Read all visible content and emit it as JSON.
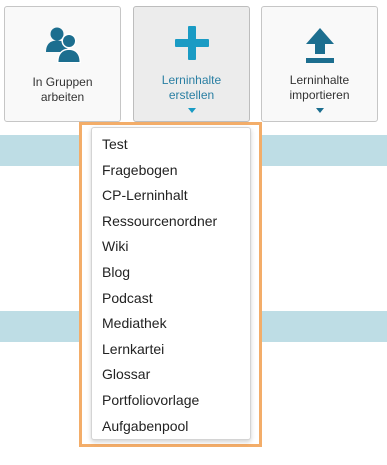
{
  "tiles": [
    {
      "label_line1": "In Gruppen",
      "label_line2": "arbeiten",
      "icon": "users-icon"
    },
    {
      "label_line1": "Lerninhalte",
      "label_line2": "erstellen",
      "icon": "plus-icon",
      "caret": "chevron-down-icon"
    },
    {
      "label_line1": "Lerninhalte",
      "label_line2": "importieren",
      "icon": "upload-icon",
      "caret": "chevron-down-icon"
    }
  ],
  "dropdown": {
    "items": [
      "Test",
      "Fragebogen",
      "CP-Lerninhalt",
      "Ressourcenordner",
      "Wiki",
      "Blog",
      "Podcast",
      "Mediathek",
      "Lernkartei",
      "Glossar",
      "Portfoliovorlage",
      "Aufgabenpool"
    ]
  },
  "colors": {
    "accent": "#1a9bc4",
    "icon_dark": "#1c6e8f",
    "band": "#bedde5",
    "highlight_border": "#f3ad69"
  }
}
